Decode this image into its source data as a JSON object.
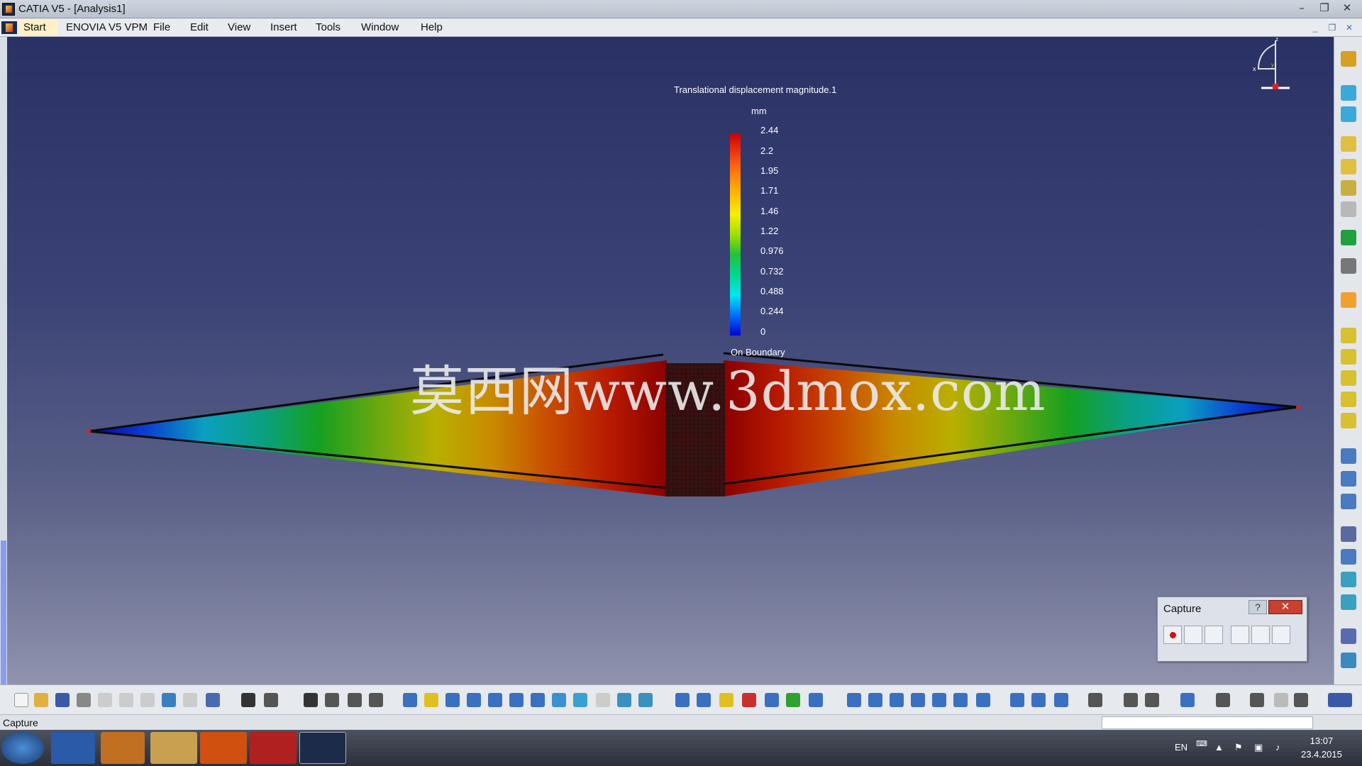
{
  "window": {
    "title": "CATIA V5 - [Analysis1]",
    "minimize": "–",
    "restore": "❐",
    "close": "✕"
  },
  "menu": [
    "Start",
    "ENOVIA V5 VPM",
    "File",
    "Edit",
    "View",
    "Insert",
    "Tools",
    "Window",
    "Help"
  ],
  "mdi": {
    "minimize": "_",
    "restore": "❐",
    "close": "✕"
  },
  "legend": {
    "title": "Translational displacement magnitude.1",
    "unit": "mm",
    "values": [
      "2.44",
      "2.2",
      "1.95",
      "1.71",
      "1.46",
      "1.22",
      "0.976",
      "0.732",
      "0.488",
      "0.244",
      "0"
    ],
    "footer": "On Boundary"
  },
  "watermark": "莫西网www.3dmox.com",
  "compass": {
    "z": "z",
    "x": "x",
    "y": "y"
  },
  "capture": {
    "title": "Capture",
    "help": "?",
    "close": "✕"
  },
  "status": {
    "text": "Capture"
  },
  "taskbar": {
    "lang": "EN",
    "time": "13:07",
    "date": "23.4.2015"
  },
  "colors": {
    "viewport_top": "#2a3164",
    "viewport_bottom": "#8f93ad",
    "max": "#cc0000",
    "min": "#0000d0"
  }
}
